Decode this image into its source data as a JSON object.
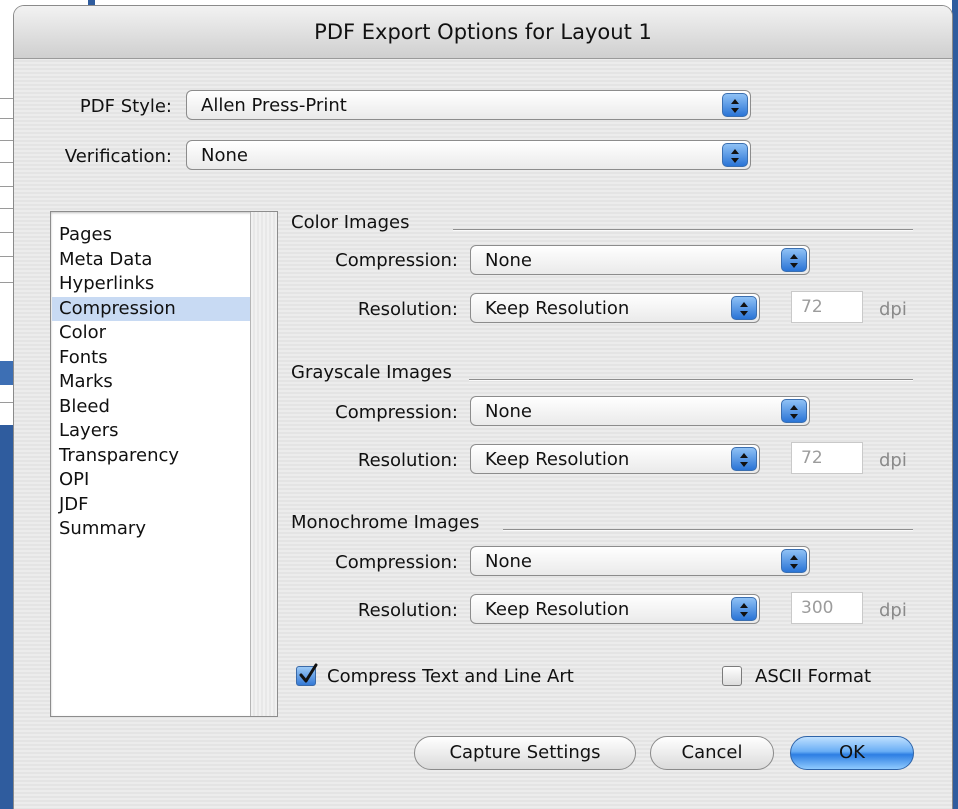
{
  "dialog": {
    "title": "PDF Export Options for Layout 1"
  },
  "pdf_style": {
    "label": "PDF Style:",
    "value": "Allen Press-Print"
  },
  "verification": {
    "label": "Verification:",
    "value": "None"
  },
  "categories": {
    "items": [
      "Pages",
      "Meta Data",
      "Hyperlinks",
      "Compression",
      "Color",
      "Fonts",
      "Marks",
      "Bleed",
      "Layers",
      "Transparency",
      "OPI",
      "JDF",
      "Summary"
    ],
    "selected": "Compression"
  },
  "color_images": {
    "title": "Color Images",
    "compression_label": "Compression:",
    "compression_value": "None",
    "resolution_label": "Resolution:",
    "resolution_value": "Keep Resolution",
    "dpi_value": "72",
    "dpi_unit": "dpi"
  },
  "grayscale_images": {
    "title": "Grayscale Images",
    "compression_label": "Compression:",
    "compression_value": "None",
    "resolution_label": "Resolution:",
    "resolution_value": "Keep Resolution",
    "dpi_value": "72",
    "dpi_unit": "dpi"
  },
  "monochrome_images": {
    "title": "Monochrome Images",
    "compression_label": "Compression:",
    "compression_value": "None",
    "resolution_label": "Resolution:",
    "resolution_value": "Keep Resolution",
    "dpi_value": "300",
    "dpi_unit": "dpi"
  },
  "options": {
    "compress_text": {
      "label": "Compress Text and Line Art",
      "checked": true
    },
    "ascii_format": {
      "label": "ASCII Format",
      "checked": false
    }
  },
  "buttons": {
    "capture": "Capture Settings",
    "cancel": "Cancel",
    "ok": "OK"
  },
  "colors": {
    "accent": "#2d7ee3",
    "selection": "#c8daf3"
  },
  "icons": {
    "popup_arrows": "up-down-arrows-icon",
    "checkmark": "checkmark-icon"
  }
}
